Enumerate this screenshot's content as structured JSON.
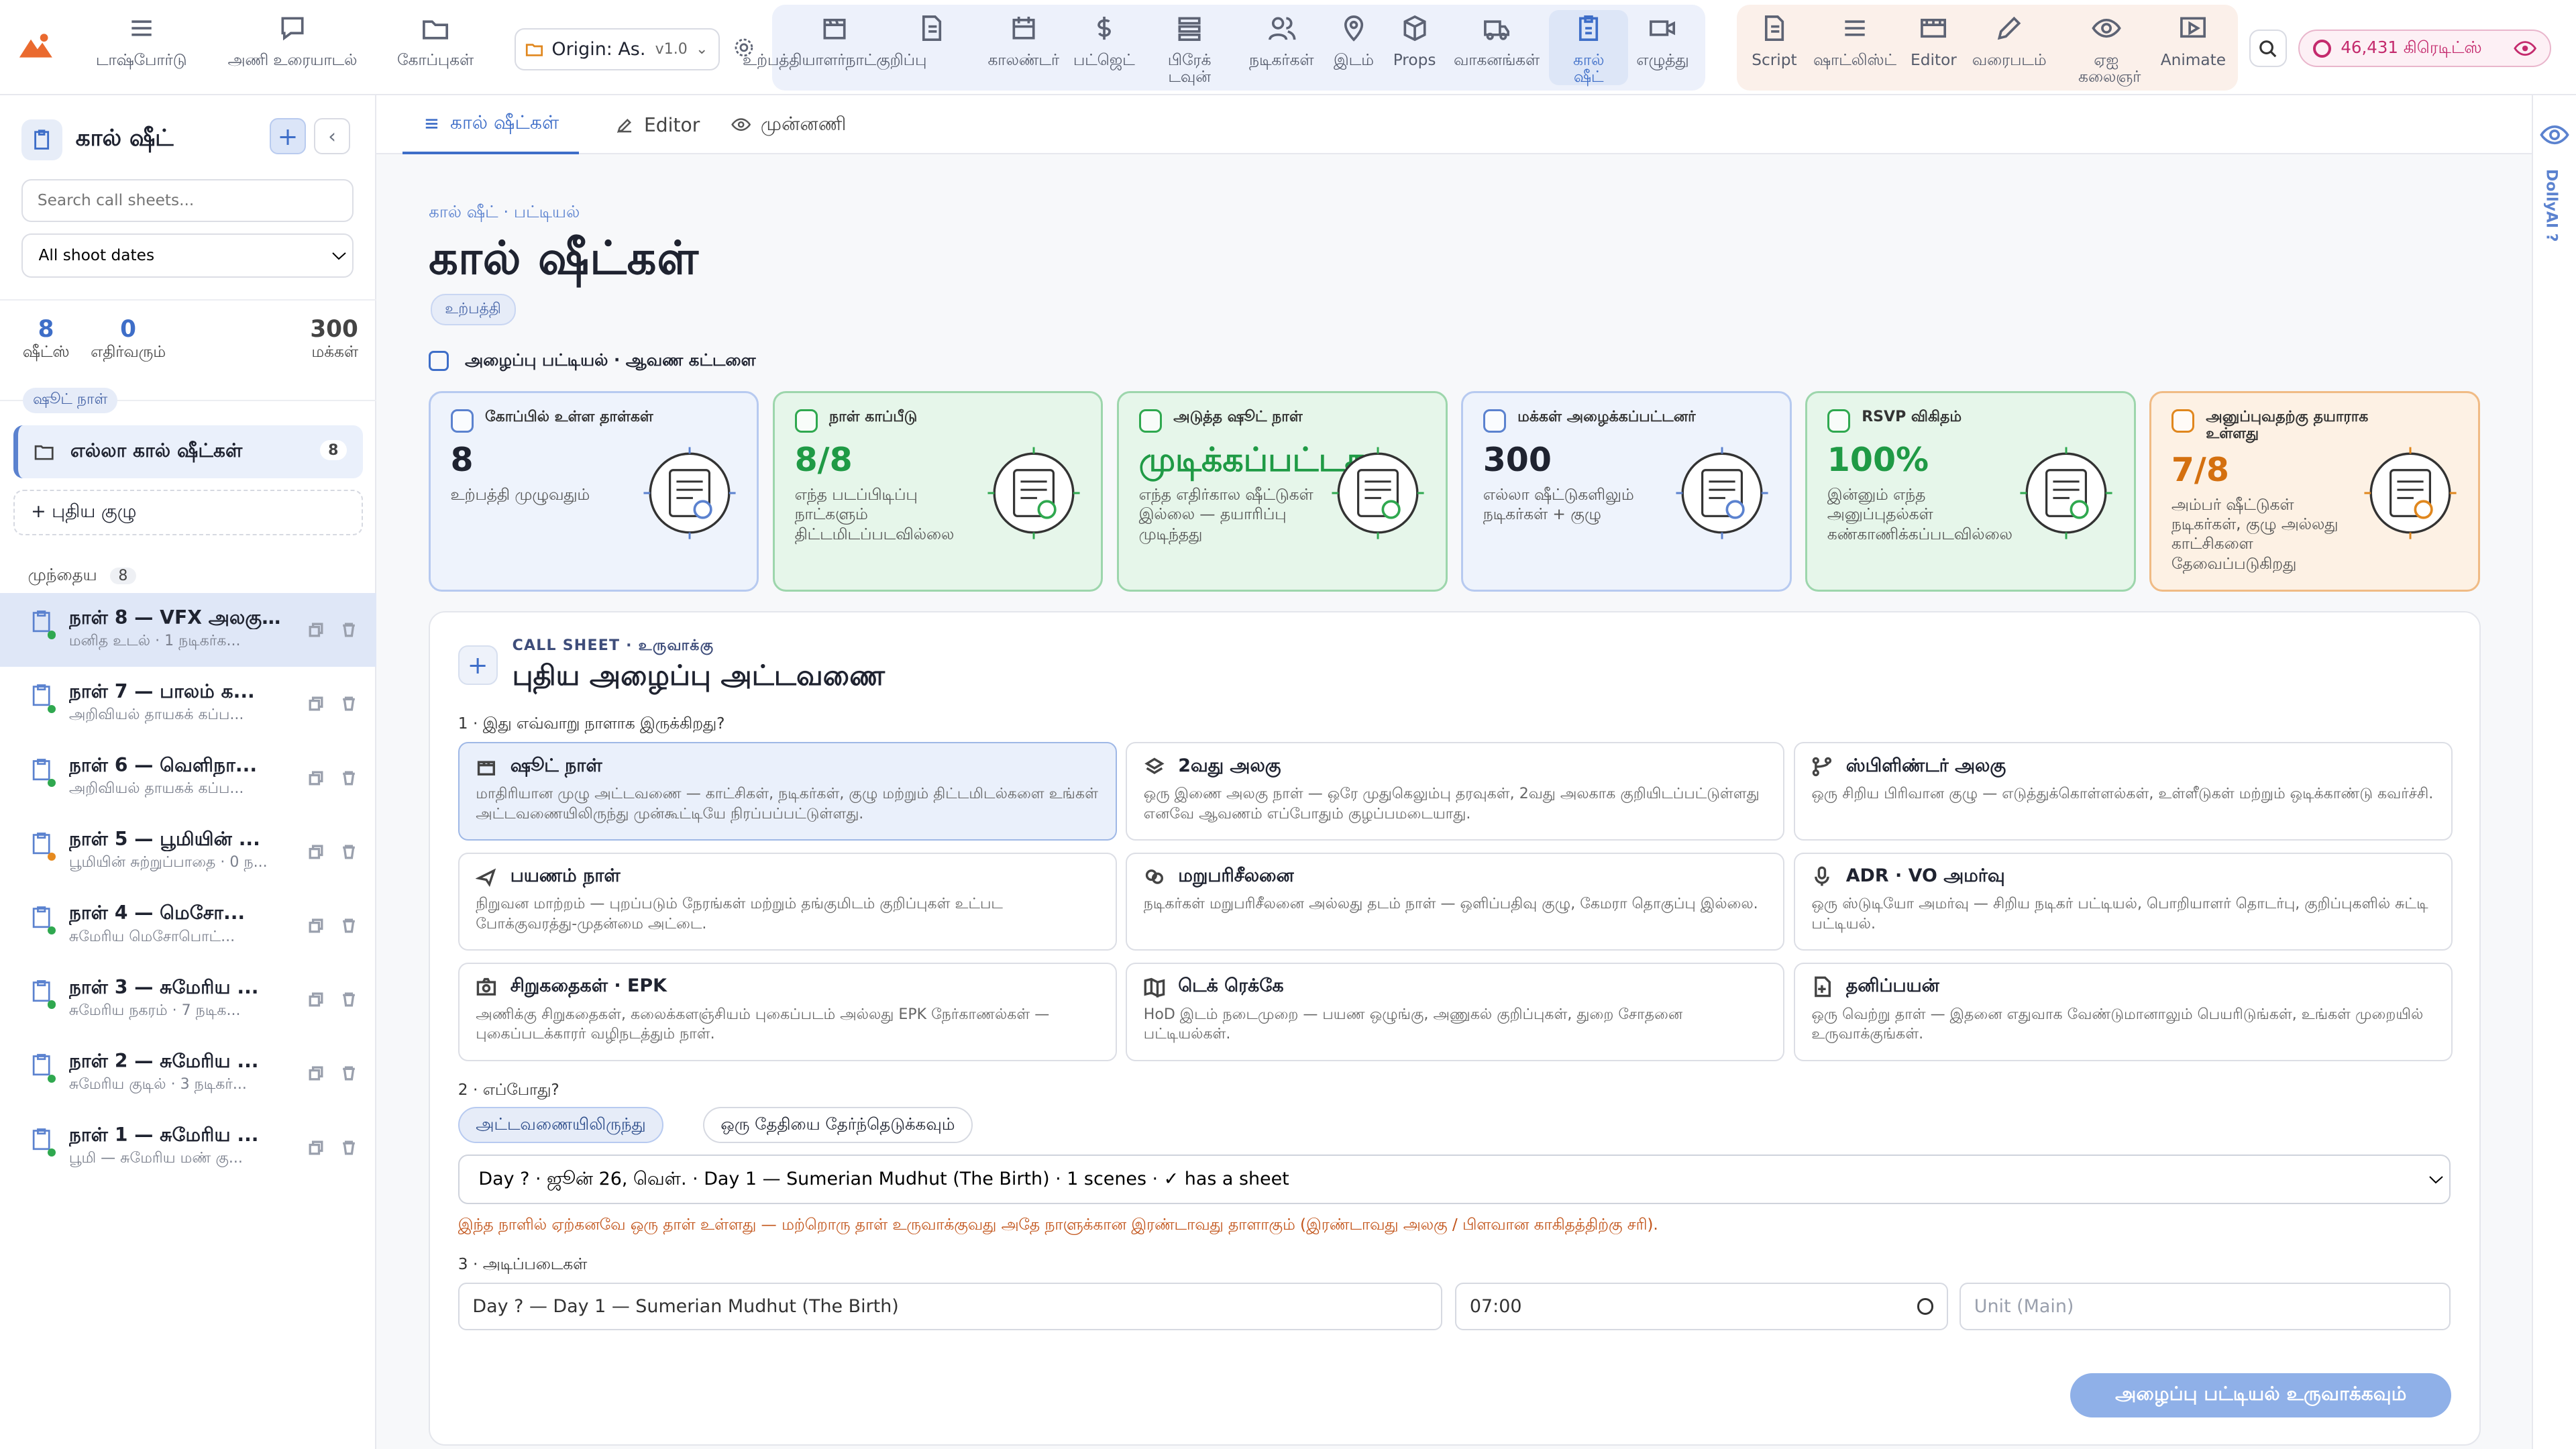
{
  "topbar": {
    "nav_left": [
      {
        "label": "டாஷ்போர்டு",
        "icon": "menu-icon"
      },
      {
        "label": "அணி உரையாடல்",
        "icon": "chat-icon"
      },
      {
        "label": "கோப்புகள்",
        "icon": "folder-icon"
      }
    ],
    "project": {
      "name": "Origin: As...",
      "version": "v1.0"
    },
    "nav_production": [
      {
        "label": "உற்பத்தியாளர்நாட்குறிப்பு",
        "icon": "clapboard-icon"
      },
      {
        "label": "காலண்டர்",
        "icon": "calendar-icon"
      },
      {
        "label": "பட்ஜெட்",
        "icon": "dollar-icon"
      },
      {
        "label": "பிரேக் டவுன்",
        "icon": "stack-icon"
      },
      {
        "label": "நடிகர்கள்",
        "icon": "people-icon"
      },
      {
        "label": "இடம்",
        "icon": "map-pin-icon"
      },
      {
        "label": "Props",
        "icon": "box-icon"
      },
      {
        "label": "வாகனங்கள்",
        "icon": "truck-icon"
      },
      {
        "label": "கால் ஷீட்",
        "icon": "clipboard-icon"
      },
      {
        "label": "எழுத்து",
        "icon": "camera-icon"
      }
    ],
    "nav_creative": [
      {
        "label": "Script",
        "icon": "document-icon"
      },
      {
        "label": "ஷாட்லிஸ்ட்",
        "icon": "list-icon"
      },
      {
        "label": "Editor",
        "icon": "film-icon"
      },
      {
        "label": "வரைபடம்",
        "icon": "pencil-icon"
      },
      {
        "label": "ஏஐ கலைஞர்",
        "icon": "eye-icon"
      },
      {
        "label": "Animate",
        "icon": "play-icon"
      }
    ],
    "credits": "46,431 கிரெடிட்ஸ்"
  },
  "sidebar": {
    "title": "கால் ஷீட்",
    "search_placeholder": "Search call sheets...",
    "date_filter": "All shoot dates",
    "stats": [
      {
        "value": "8",
        "label": "ஷீட்ஸ்"
      },
      {
        "value": "0",
        "label": "எதிர்வரும்"
      },
      {
        "value": "300",
        "label": "மக்கள்"
      }
    ],
    "shoot_day_chip": "ஷூட் நாள்",
    "all_sheets": {
      "label": "எல்லா கால் ஷீட்கள்",
      "count": "8"
    },
    "new_group": "+ புதிய குழு",
    "section": {
      "label": "முந்தைய",
      "count": "8"
    },
    "items": [
      {
        "title": "நாள் 8 — VFX அலகு:...",
        "sub": "மனித உடல் · 1 நடிகர்க..."
      },
      {
        "title": "நாள் 7 — பாலம் க...",
        "sub": "அறிவியல் தாயகக் கப்ப..."
      },
      {
        "title": "நாள் 6 — வெளிநா...",
        "sub": "அறிவியல் தாயகக் கப்ப..."
      },
      {
        "title": "நாள் 5 — பூமியின் ...",
        "sub": "பூமியின் சுற்றுப்பாதை · 0 ந..."
      },
      {
        "title": "நாள் 4 — மெசோ...",
        "sub": "சுமேரிய மெசோபொட்..."
      },
      {
        "title": "நாள் 3 — சுமேரிய ...",
        "sub": "சுமேரிய நகரம் · 7 நடிக..."
      },
      {
        "title": "நாள் 2 — சுமேரிய ...",
        "sub": "சுமேரிய குடில் · 3 நடிகர்..."
      },
      {
        "title": "நாள் 1 — சுமேரிய ...",
        "sub": "பூமி — சுமேரிய மண் கு..."
      }
    ]
  },
  "tabs": [
    {
      "label": "கால் ஷீட்கள்",
      "icon": "list-icon"
    },
    {
      "label": "Editor",
      "icon": "edit-icon"
    },
    {
      "label": "முன்னணி",
      "icon": "eye-icon"
    }
  ],
  "page": {
    "breadcrumb": "கால் ஷீட் · பட்டியல்",
    "title": "கால் ஷீட்கள்",
    "badge": "உற்பத்தி",
    "section": "அழைப்பு பட்டியல் · ஆவண கட்டளை"
  },
  "cards": [
    {
      "label": "கோப்பில் உள்ள தாள்கள்",
      "value": "8",
      "sub": "உற்பத்தி முழுவதும்"
    },
    {
      "label": "நாள் காப்பீடு",
      "value": "8/8",
      "sub": "எந்த படப்பிடிப்பு நாட்களும் திட்டமிடப்படவில்லை"
    },
    {
      "label": "அடுத்த ஷூட் நாள்",
      "value": "முடிக்கப்பட்டது",
      "sub": "எந்த எதிர்கால ஷீட்டுகள் இல்லை — தயாரிப்பு முடிந்தது"
    },
    {
      "label": "மக்கள் அழைக்கப்பட்டனர்",
      "value": "300",
      "sub": "எல்லா ஷீட்டுகளிலும் நடிகர்கள் + குழு"
    },
    {
      "label": "RSVP விகிதம்",
      "value": "100%",
      "sub": "இன்னும் எந்த அனுப்புதல்கள் கண்காணிக்கப்படவில்லை"
    },
    {
      "label": "அனுப்புவதற்கு தயாராக உள்ளது",
      "value": "7/8",
      "sub": "அம்பர் ஷீட்டுகள் நடிகர்கள், குழு அல்லது காட்சிகளை தேவைப்படுகிறது"
    }
  ],
  "creator": {
    "kicker": "CALL SHEET · உருவாக்கு",
    "title": "புதிய அழைப்பு அட்டவணை",
    "step1": "1 · இது எவ்வாறு நாளாக இருக்கிறது?",
    "options": [
      {
        "title": "ஷூட் நாள்",
        "desc": "மாதிரியான முழு அட்டவணை — காட்சிகள், நடிகர்கள், குழு மற்றும் திட்டமிடல்களை உங்கள் அட்டவணையிலிருந்து முன்கூட்டியே நிரப்பப்பட்டுள்ளது."
      },
      {
        "title": "2வது அலகு",
        "desc": "ஒரு இணை அலகு நாள் — ஒரே முதுகெலும்பு தரவுகள், 2வது அலகாக குறியிடப்பட்டுள்ளது எனவே ஆவணம் எப்போதும் குழப்பமடையாது."
      },
      {
        "title": "ஸ்பிளிண்டர் அலகு",
        "desc": "ஒரு சிறிய பிரிவான குழு — எடுத்துக்கொள்ளல்கள், உள்ளீடுகள் மற்றும் ஒடிக்காண்டு கவர்ச்சி."
      },
      {
        "title": "பயணம் நாள்",
        "desc": "நிறுவன மாற்றம் — புறப்படும் நேரங்கள் மற்றும் தங்குமிடம் குறிப்புகள் உட்பட போக்குவரத்து-முதன்மை அட்டை."
      },
      {
        "title": "மறுபரிசீலனை",
        "desc": "நடிகர்கள் மறுபரிசீலனை அல்லது தடம் நாள் — ஒளிப்பதிவு குழு, கேமரா தொகுப்பு இல்லை."
      },
      {
        "title": "ADR · VO அமர்வு",
        "desc": "ஒரு ஸ்டுடியோ அமர்வு — சிறிய நடிகர் பட்டியல், பொறியாளர் தொடர்பு, குறிப்புகளில் சுட்டி பட்டியல்."
      },
      {
        "title": "சிறுகதைகள் · EPK",
        "desc": "அணிக்கு சிறுகதைகள், கலைக்களஞ்சியம் புகைப்படம் அல்லது EPK நேர்காணல்கள் — புகைப்படக்காரர் வழிநடத்தும் நாள்."
      },
      {
        "title": "டெக் ரெக்கே",
        "desc": "HoD இடம் நடைமுறை — பயண ஒழுங்கு, அணுகல் குறிப்புகள், துறை சோதனை பட்டியல்கள்."
      },
      {
        "title": "தனிப்பயன்",
        "desc": "ஒரு வெற்று தாள் — இதனை எதுவாக வேண்டுமானாலும் பெயரிடுங்கள், உங்கள் முறையில் உருவாக்குங்கள்."
      }
    ],
    "step2": "2 · எப்போது?",
    "seg_on": "அட்டவணையிலிருந்து",
    "seg_off": "ஒரு தேதியை தேர்ந்தெடுக்கவும்",
    "day_select": "Day ? · ஜூன் 26, வெள். · Day 1 — Sumerian Mudhut (The Birth) · 1 scenes · ✓ has a sheet",
    "warning": "இந்த நாளில் ஏற்கனவே ஒரு தாள் உள்ளது — மற்றொரு தாள் உருவாக்குவது அதே நாளுக்கான இரண்டாவது தாளாகும் (இரண்டாவது அலகு / பிளவான காகிதத்திற்கு சரி).",
    "step3": "3 · அடிப்படைகள்",
    "name_value": "Day ? — Day 1 — Sumerian Mudhut (The Birth)",
    "time_value": "07:00",
    "unit_placeholder": "Unit (Main)",
    "cta": "அழைப்பு பட்டியல் உருவாக்கவும்"
  },
  "rail": {
    "label": "DollyAI ?"
  },
  "colors": {
    "accent": "#3e6ec8",
    "success": "#1f9a45",
    "warning": "#d4700f",
    "credits": "#c42a6d"
  }
}
